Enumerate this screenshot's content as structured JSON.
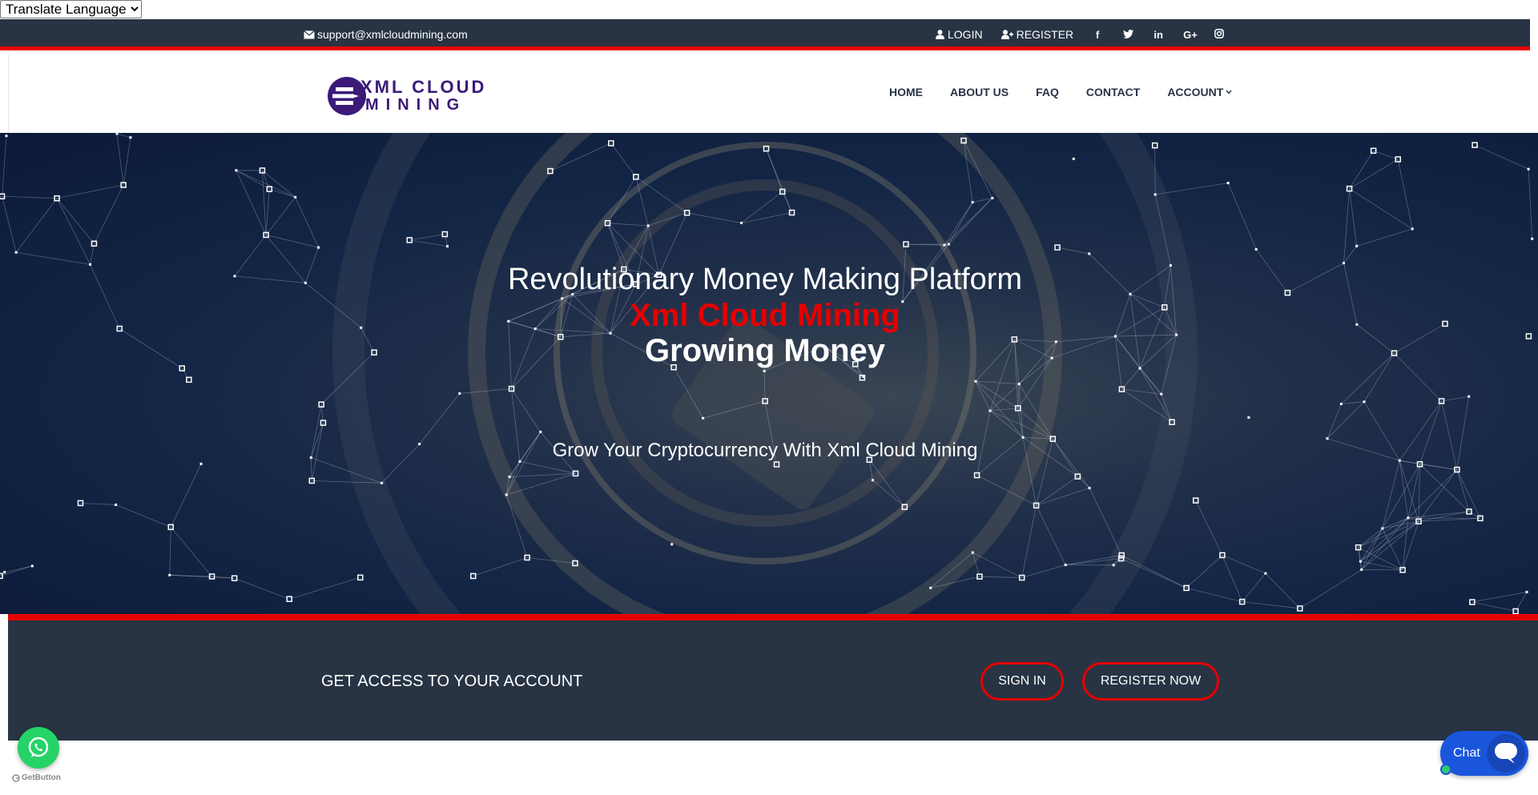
{
  "translate": {
    "selected": "Translate Language"
  },
  "topbar": {
    "email": "support@xmlcloudmining.com",
    "login": "LOGIN",
    "register": "REGISTER",
    "social": [
      "facebook-icon",
      "twitter-icon",
      "linkedin-icon",
      "google-plus-icon",
      "instagram-icon"
    ]
  },
  "logo": {
    "line1": "XML CLOUD",
    "line2": "MINING"
  },
  "nav": {
    "home": "HOME",
    "about": "ABOUT US",
    "faq": "FAQ",
    "contact": "CONTACT",
    "account": "ACCOUNT"
  },
  "hero": {
    "title": "Revolutionary Money Making Platform",
    "brand": "Xml Cloud Mining",
    "tagline": "Growing Money",
    "subtitle": "Grow Your Cryptocurrency With Xml Cloud Mining"
  },
  "access": {
    "heading": "GET ACCESS TO YOUR ACCOUNT",
    "signin": "SIGN IN",
    "register": "REGISTER NOW"
  },
  "widgets": {
    "getbutton": "GetButton",
    "chat": "Chat"
  },
  "colors": {
    "dark": "#283444",
    "accent": "#e60000",
    "logo": "#3b1a78",
    "chat": "#1a56db",
    "whatsapp": "#25d366"
  }
}
